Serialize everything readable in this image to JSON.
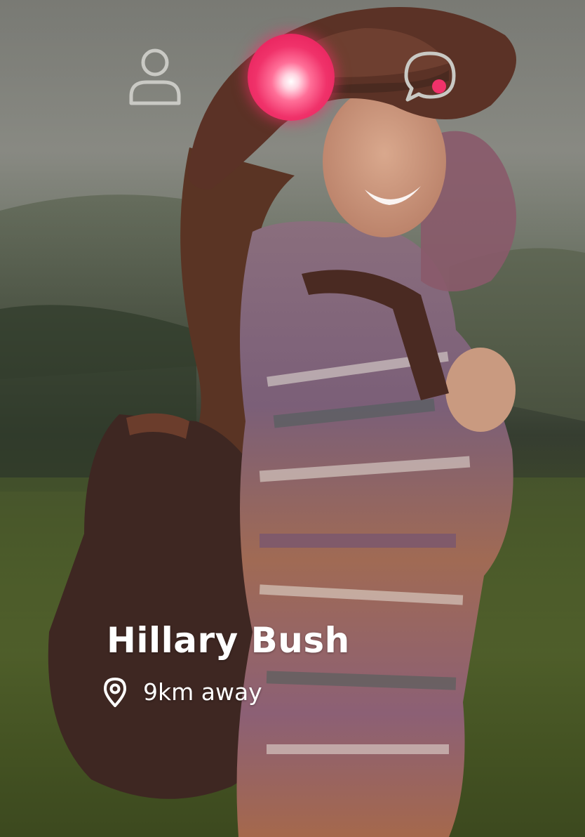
{
  "nav": {
    "profile_icon": "user-icon",
    "home_icon": "home-orb-icon",
    "chat_icon": "chat-bubble-icon",
    "chat_has_notification": true
  },
  "profile": {
    "name": "Hillary Bush",
    "distance": "9km away",
    "location_icon": "map-pin-icon"
  },
  "colors": {
    "accent": "#f0326a",
    "text": "#ffffff",
    "nav_icon": "#c9c9c4"
  }
}
